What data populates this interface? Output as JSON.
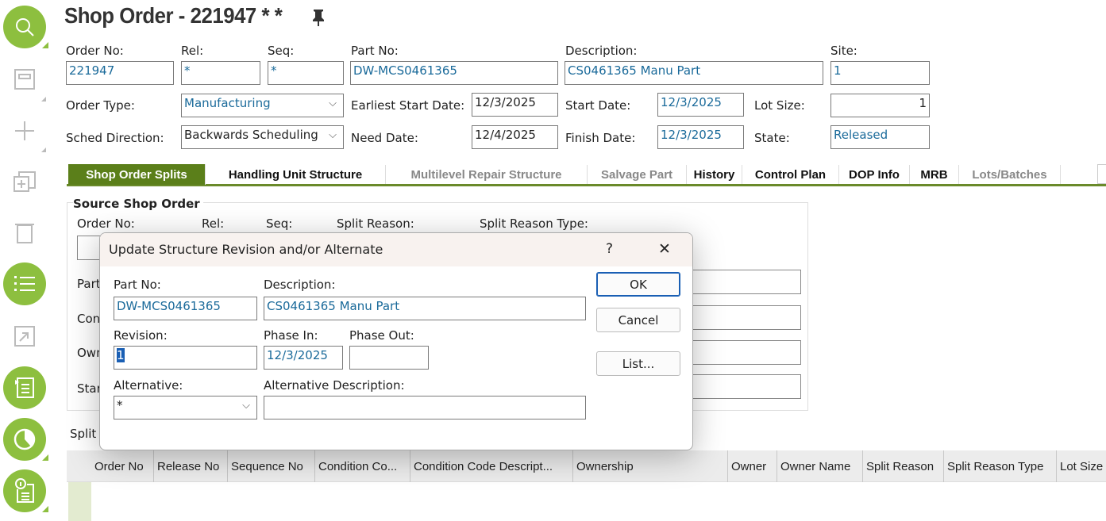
{
  "title": "Shop Order - 221947 * *",
  "header": {
    "order_no_label": "Order No:",
    "order_no": "221947",
    "rel_label": "Rel:",
    "rel": "*",
    "seq_label": "Seq:",
    "seq": "*",
    "part_no_label": "Part No:",
    "part_no": "DW-MCS0461365",
    "description_label": "Description:",
    "description": "CS0461365 Manu Part",
    "site_label": "Site:",
    "site": "1",
    "order_type_label": "Order Type:",
    "order_type": "Manufacturing",
    "earliest_start_label": "Earliest Start Date:",
    "earliest_start": "12/3/2025",
    "start_date_label": "Start Date:",
    "start_date": "12/3/2025",
    "lot_size_label": "Lot Size:",
    "lot_size": "1",
    "sched_direction_label": "Sched Direction:",
    "sched_direction": "Backwards Scheduling",
    "need_date_label": "Need Date:",
    "need_date": "12/4/2025",
    "finish_date_label": "Finish Date:",
    "finish_date": "12/3/2025",
    "state_label": "State:",
    "state": "Released"
  },
  "tabs": [
    "Shop Order Splits",
    "Handling Unit Structure",
    "Multilevel Repair Structure",
    "Salvage Part",
    "History",
    "Control Plan",
    "DOP Info",
    "MRB",
    "Lots/Batches"
  ],
  "source": {
    "title": "Source Shop Order",
    "order_no": "Order No:",
    "rel": "Rel:",
    "seq": "Seq:",
    "split_reason": "Split Reason:",
    "split_reason_type": "Split Reason Type:",
    "part": "Part",
    "con": "Con",
    "own": "Own",
    "star": "Star",
    "split": "Split"
  },
  "grid": {
    "columns": [
      "Order No",
      "Release No",
      "Sequence No",
      "Condition Co...",
      "Condition Code Descript...",
      "Ownership",
      "Owner",
      "Owner Name",
      "Split Reason",
      "Split Reason Type",
      "Lot Size"
    ]
  },
  "dialog": {
    "title": "Update Structure Revision and/or Alternate",
    "help": "?",
    "close": "✕",
    "part_no_label": "Part No:",
    "part_no": "DW-MCS0461365",
    "description_label": "Description:",
    "description": "CS0461365 Manu Part",
    "revision_label": "Revision:",
    "revision": "1",
    "phase_in_label": "Phase In:",
    "phase_in": "12/3/2025",
    "phase_out_label": "Phase Out:",
    "phase_out": "",
    "alternative_label": "Alternative:",
    "alternative": "*",
    "alt_desc_label": "Alternative Description:",
    "alt_desc": "",
    "ok": "OK",
    "cancel": "Cancel",
    "list": "List..."
  }
}
